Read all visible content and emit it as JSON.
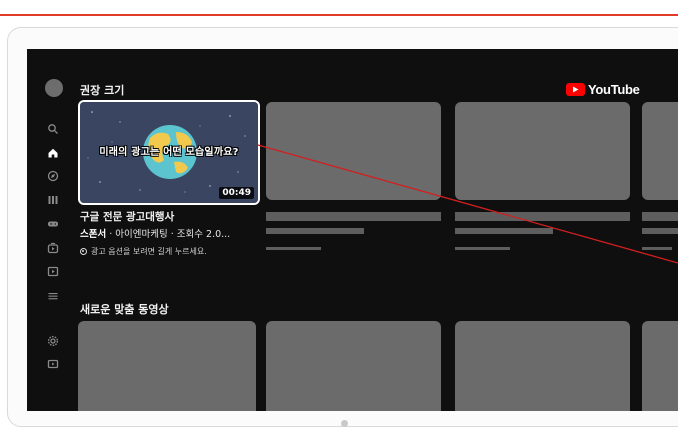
{
  "colors": {
    "accent_rule": "#e23b2a",
    "screen_bg": "#0f0f0f",
    "placeholder": "#6b6b6b",
    "youtube_red": "#ff0000",
    "callout_line": "#d21f1f"
  },
  "logo": {
    "text": "YouTube",
    "icon": "youtube-play-icon"
  },
  "sidebar": {
    "icons": [
      "avatar",
      "search-icon",
      "home-icon",
      "explore-icon",
      "library-icon",
      "gaming-icon",
      "kids-icon",
      "subscriptions-icon",
      "menu-icon",
      "settings-icon",
      "tv-icon"
    ]
  },
  "sections": {
    "recommended": {
      "title": "권장 크기"
    },
    "new_for_you": {
      "title": "새로운 맞춤 동영상"
    }
  },
  "featured_ad": {
    "thumbnail_title": "미래의 광고는 어떤 모습일까요?",
    "duration": "00:49",
    "channel_title": "구글 전문 광고대행사",
    "sponsor_label": "스폰서",
    "sponsor_meta": " · 아이엔마케팅 · 조회수 2.0...",
    "hint": "광고 옵션을 보려면 길게 누르세요."
  }
}
